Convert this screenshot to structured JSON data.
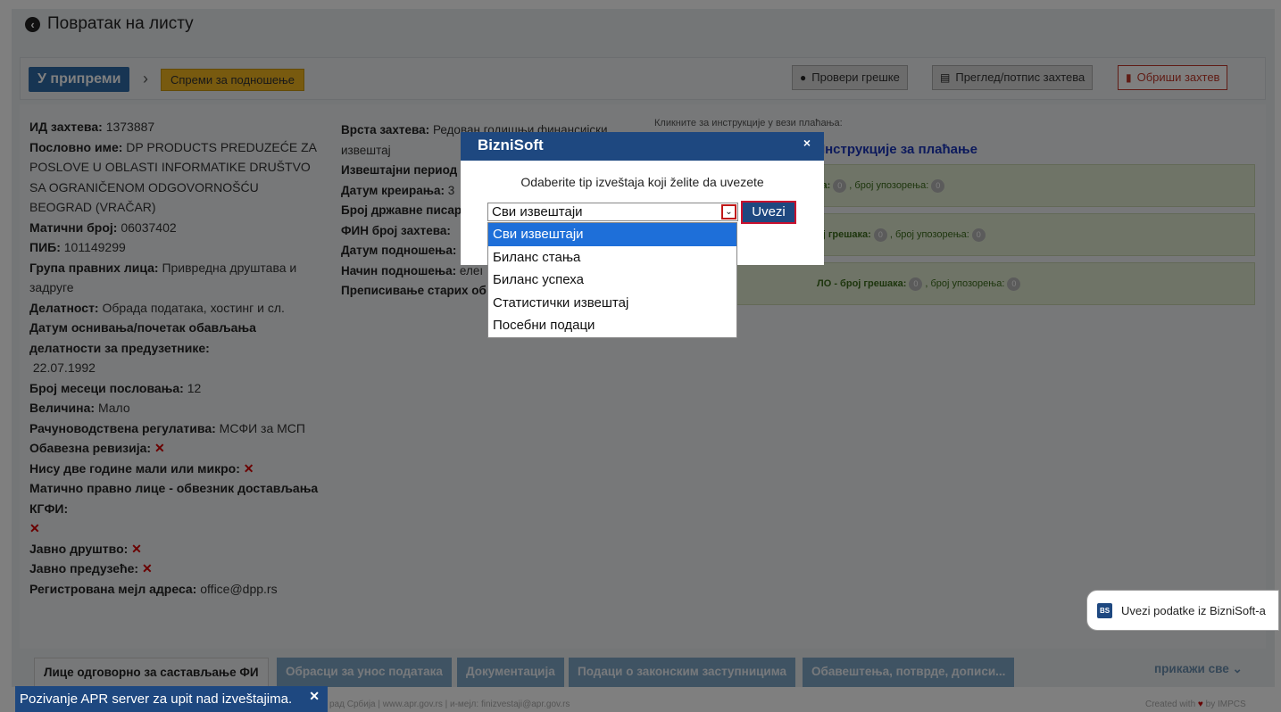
{
  "header": {
    "back_label": "Повратак на листу",
    "status_badge": "У припреми",
    "prepare_button": "Спреми за подношење",
    "check_errors_button": "Провери грешке",
    "preview_button": "Преглед/потпис захтева",
    "delete_button": "Обриши захтев"
  },
  "info_left": {
    "request_id_label": "ИД захтева:",
    "request_id": "1373887",
    "business_name_label": "Пословно име:",
    "business_name": "DP PRODUCTS PREDUZEĆE ZA POSLOVE U OBLASTI INFORMATIKE DRUŠTVO SA OGRANIČENOM ODGOVORNOŠĆU BEOGRAD (VRAČAR)",
    "reg_no_label": "Матични број:",
    "reg_no": "06037402",
    "pib_label": "ПИБ:",
    "pib": "101149299",
    "group_label": "Група правних лица:",
    "group": "Привредна друштава и задруге",
    "activity_label": "Делатност:",
    "activity": "Обрада података, хостинг и сл.",
    "founding_label": "Датум оснивања/почетак обављања делатности за предузетнике:",
    "founding": "22.07.1992",
    "months_label": "Број месеци пословања:",
    "months": "12",
    "size_label": "Величина:",
    "size": "Мало",
    "regulation_label": "Рачуноводствена регулатива:",
    "regulation": "МСФИ  за МСП",
    "audit_label": "Обавезна ревизија:",
    "not_two_years_label": "Нису две године мали или микро:",
    "parent_label": "Матично правно лице - обвезник достављања КГФИ:",
    "public_company_label": "Јавно друштво:",
    "public_enterprise_label": "Јавно предузеће:",
    "email_label": "Регистрована мејл адреса:",
    "email": "office@dpp.rs",
    "x_mark": "✕"
  },
  "info_mid": {
    "type_label": "Врста захтева:",
    "type_value": "Редован годишњи финансијски",
    "type_value_2": "извештај",
    "period_label": "Извештајни период",
    "created_label": "Датум креирања:",
    "created_value": "3",
    "paper_label": "Број државне писар",
    "fin_label": "ФИН број захтева:",
    "submit_date_label": "Датум подношења:",
    "method_label": "Начин подношења:",
    "method_value": "елеı",
    "rewrite_label": "Преписивање старих об"
  },
  "payment": {
    "note": "Кликните за инструкције у вези плаћања:",
    "link": "/ Инструкције за плаћање"
  },
  "green_rows": [
    {
      "prefix": "ка:",
      "errors": "0",
      "warn_label": ", број упозорења:",
      "warnings": "0"
    },
    {
      "prefix": "ој грешака:",
      "errors": "0",
      "warn_label": ", број упозорења:",
      "warnings": "0"
    },
    {
      "prefix": "ЛО - број грешака:",
      "errors": "0",
      "warn_label": ", број упозорења:",
      "warnings": "0"
    }
  ],
  "dialog": {
    "title": "BizniSoft",
    "close": "×",
    "question": "Odaberite tip izveštaja koji želite da uvezete",
    "selected": "Сви извештаји",
    "import_button": "Uvezi",
    "options": [
      "Сви извештаји",
      "Биланс стања",
      "Биланс успеха",
      "Статистички извештај",
      "Посебни подаци"
    ]
  },
  "bizni_float": {
    "logo": "BS",
    "label": "Uvezi podatke iz BizniSoft-a"
  },
  "tabs": [
    "Лице одговорно за састављање ФИ",
    "Обрасци за унос података",
    "Документација",
    "Подаци о законским заступницима",
    "Обавештења, потврде, дописи..."
  ],
  "show_all": "прикажи све ⌄",
  "footer": {
    "mid": "рад Србија | www.apr.gov.rs | и-мејл: finizvestaji@apr.gov.rs",
    "right_prefix": "Created with",
    "right_suffix": "by IMPCS"
  },
  "toast": {
    "text": "Pozivanje APR server za upit nad izveštajima.",
    "close": "✕"
  }
}
